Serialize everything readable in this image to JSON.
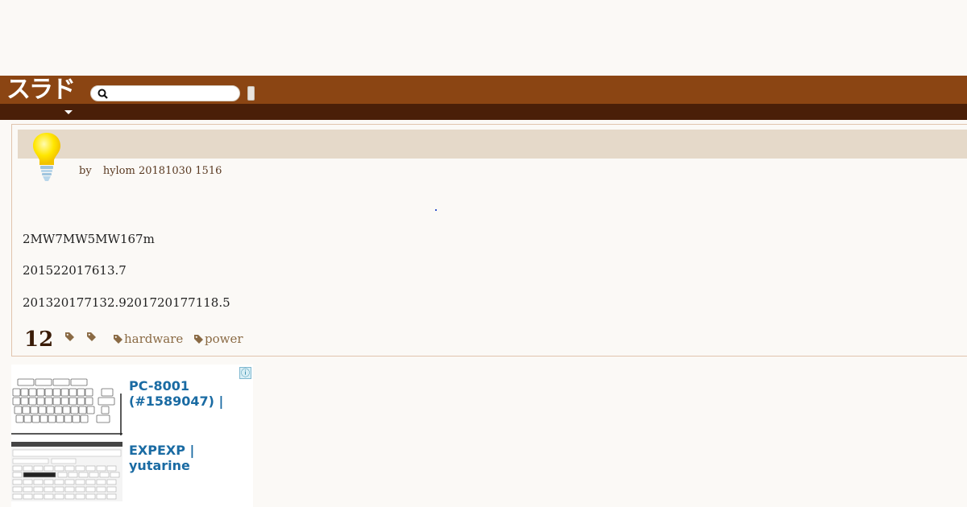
{
  "site": {
    "logo_text": "スラド",
    "search_placeholder": ""
  },
  "article": {
    "byline_prefix": "by",
    "author": "hylom",
    "timestamp": "20181030 1516",
    "paragraphs": [
      "2MW7MW5MW167m",
      "201522017613.7",
      "201320177132.9201720177118.5"
    ],
    "comment_count": "12",
    "tags": [
      "",
      "",
      "hardware",
      "power"
    ]
  },
  "ads": {
    "info_label": "ⓘ",
    "items": [
      {
        "title": "PC-8001 (#1589047) |"
      },
      {
        "title": "EXPEXP | yutarine"
      }
    ]
  },
  "colors": {
    "header": "#8b4513",
    "subnav": "#4a1f08",
    "title_bar": "#e5d9c9",
    "tag": "#8a6a44",
    "ad_link": "#1a6ba3"
  }
}
